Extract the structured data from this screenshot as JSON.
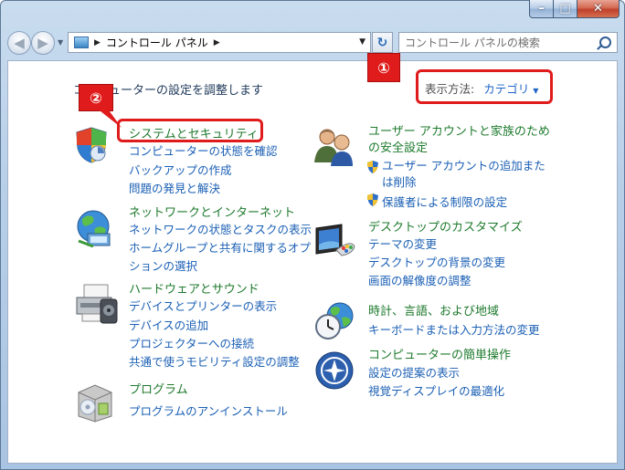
{
  "window": {
    "caption_buttons": {
      "minimize": "–",
      "maximize": "□",
      "close": "✕"
    }
  },
  "nav": {
    "address_root": "コントロール パネル",
    "search_placeholder": "コントロール パネルの検索"
  },
  "main": {
    "heading": "コンピューターの設定を調整します",
    "view_by_label": "表示方法:",
    "view_by_value": "カテゴリ"
  },
  "categories_left": [
    {
      "title": "システムとセキュリティ",
      "icon": "shield-icon",
      "links": [
        "コンピューターの状態を確認",
        "バックアップの作成",
        "問題の発見と解決"
      ]
    },
    {
      "title": "ネットワークとインターネット",
      "icon": "network-globe-icon",
      "links": [
        "ネットワークの状態とタスクの表示",
        "ホームグループと共有に関するオプションの選択"
      ]
    },
    {
      "title": "ハードウェアとサウンド",
      "icon": "printer-icon",
      "links": [
        "デバイスとプリンターの表示",
        "デバイスの追加",
        "プロジェクターへの接続",
        "共通で使うモビリティ設定の調整"
      ]
    },
    {
      "title": "プログラム",
      "icon": "programs-box-icon",
      "links": [
        "プログラムのアンインストール"
      ]
    }
  ],
  "categories_right": [
    {
      "title": "ユーザー アカウントと家族のための安全設定",
      "icon": "users-icon",
      "links": [
        "ユーザー アカウントの追加または削除",
        "保護者による制限の設定"
      ]
    },
    {
      "title": "デスクトップのカスタマイズ",
      "icon": "desktop-display-icon",
      "links": [
        "テーマの変更",
        "デスクトップの背景の変更",
        "画面の解像度の調整"
      ]
    },
    {
      "title": "時計、言語、および地域",
      "icon": "clock-globe-icon",
      "links": [
        "キーボードまたは入力方法の変更"
      ]
    },
    {
      "title": "コンピューターの簡単操作",
      "icon": "ease-of-access-icon",
      "links": [
        "設定の提案の表示",
        "視覚ディスプレイの最適化"
      ]
    }
  ],
  "annotations": {
    "one": "①",
    "two": "②"
  },
  "colors": {
    "link": "#1a5fb4",
    "category": "#1e7a2d",
    "annotation": "#e01b1b"
  }
}
